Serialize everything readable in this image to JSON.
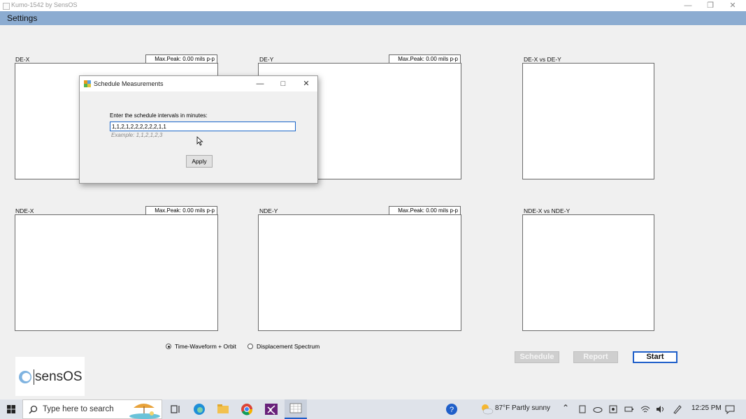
{
  "window": {
    "title": "Kumo-1542 by SensOS"
  },
  "menu": {
    "settings": "Settings"
  },
  "panels": {
    "dex": {
      "label": "DE-X",
      "max_peak": "Max.Peak: 0.00 mils p-p"
    },
    "dey": {
      "label": "DE-Y",
      "max_peak": "Max.Peak: 0.00 mils p-p"
    },
    "dexy": {
      "label": "DE-X vs DE-Y"
    },
    "ndex": {
      "label": "NDE-X",
      "max_peak": "Max.Peak: 0.00 mils p-p"
    },
    "ndey": {
      "label": "NDE-Y",
      "max_peak": "Max.Peak: 0.00 mils p-p"
    },
    "ndexy": {
      "label": "NDE-X vs NDE-Y"
    }
  },
  "mode": {
    "option1": "Time-Waveform + Orbit",
    "option2": "Displacement Spectrum",
    "selected": "Time-Waveform + Orbit"
  },
  "buttons": {
    "schedule": "Schedule",
    "report": "Report",
    "start": "Start"
  },
  "logo": {
    "text": "sensOS"
  },
  "dialog": {
    "title": "Schedule Measurements",
    "prompt": "Enter the schedule intervals in minutes:",
    "value": "1,1,2,1,2,2,2,2,2,2,1,1",
    "example": "Example: 1,1,2,1,2,3",
    "apply": "Apply"
  },
  "taskbar": {
    "search_placeholder": "Type here to search",
    "weather": "87°F  Partly sunny",
    "time": "12:25 PM"
  },
  "colors": {
    "menubar": "#8cacd1",
    "accent": "#1f5fc9"
  }
}
